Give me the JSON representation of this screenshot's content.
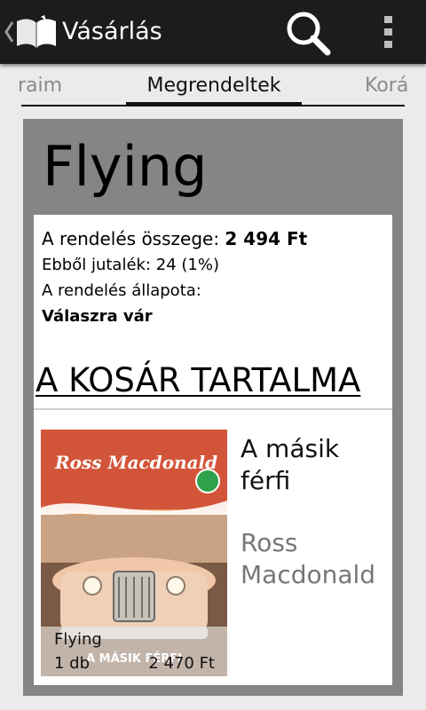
{
  "app_bar": {
    "title": "Vásárlás",
    "icons": [
      "up-caret-icon",
      "book-icon",
      "search-icon",
      "overflow-menu-icon"
    ]
  },
  "tabs": {
    "previous": "raim",
    "current": "Megrendeltek",
    "next": "Korá"
  },
  "order": {
    "title": "Flying",
    "total_label": "A rendelés összege: ",
    "total_value": "2 494 Ft",
    "commission": "Ebből jutalék: 24 (1%)",
    "status_label": "A rendelés állapota:",
    "status_value": "Válaszra vár"
  },
  "cart": {
    "heading": "A KOSÁR TARTALMA",
    "items": [
      {
        "title": "A másik férfi",
        "author": "Ross Macdonald",
        "cover_author": "Ross Macdonald",
        "cover_title": "A MÁSIK FÉRFI",
        "shop": "Flying",
        "quantity": "1 db",
        "price": "2 470 Ft"
      }
    ]
  },
  "colors": {
    "action_bar": "#1c1c1c",
    "background": "#ebebeb",
    "card": "#858585",
    "panel": "#ffffff",
    "author_text": "#777777"
  }
}
